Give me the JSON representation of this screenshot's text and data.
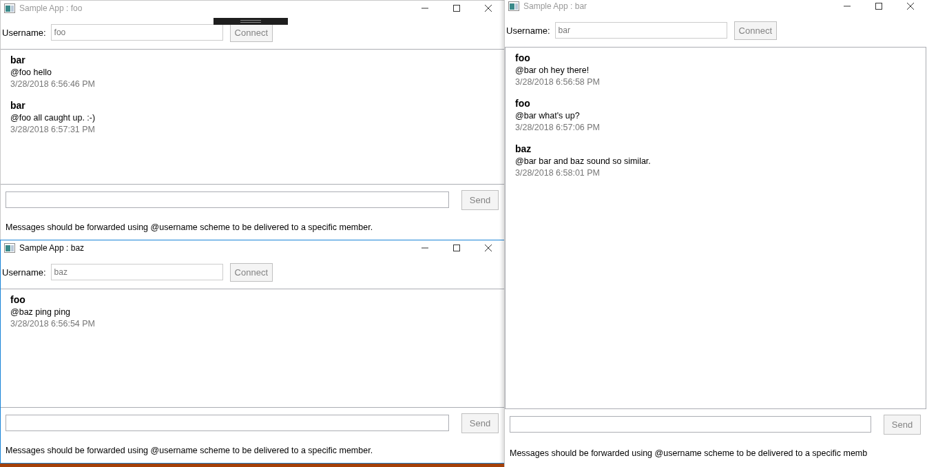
{
  "windows": [
    {
      "title": "Sample App : foo",
      "active": false,
      "username_label": "Username:",
      "username": {
        "value": "foo",
        "disabled": true
      },
      "connect_button": {
        "label": "Connect",
        "disabled": true
      },
      "messages": [
        {
          "sender": "bar",
          "text": "@foo hello",
          "time": "3/28/2018 6:56:46 PM"
        },
        {
          "sender": "bar",
          "text": "@foo all caught up. :-)",
          "time": "3/28/2018 6:57:31 PM"
        }
      ],
      "send_button": {
        "label": "Send",
        "disabled": true
      },
      "hint": "Messages should be forwarded using @username scheme to be delivered to a specific member."
    },
    {
      "title": "Sample App : baz",
      "active": true,
      "username_label": "Username:",
      "username": {
        "value": "baz",
        "disabled": true
      },
      "connect_button": {
        "label": "Connect",
        "disabled": true
      },
      "messages": [
        {
          "sender": "foo",
          "text": "@baz ping ping",
          "time": "3/28/2018 6:56:54 PM"
        }
      ],
      "send_button": {
        "label": "Send",
        "disabled": true
      },
      "hint": "Messages should be forwarded using @username scheme to be delivered to a specific member."
    },
    {
      "title": "Sample App : bar",
      "active": false,
      "username_label": "Username:",
      "username": {
        "value": "bar",
        "disabled": true
      },
      "connect_button": {
        "label": "Connect",
        "disabled": true
      },
      "messages": [
        {
          "sender": "foo",
          "text": "@bar oh hey there!",
          "time": "3/28/2018 6:56:58 PM"
        },
        {
          "sender": "foo",
          "text": "@bar what's up?",
          "time": "3/28/2018 6:57:06 PM"
        },
        {
          "sender": "baz",
          "text": "@bar bar and baz sound so similar.",
          "time": "3/28/2018 6:58:01 PM"
        }
      ],
      "send_button": {
        "label": "Send",
        "disabled": true
      },
      "hint": "Messages should be forwarded using @username scheme to be delivered to a specific memb"
    }
  ]
}
